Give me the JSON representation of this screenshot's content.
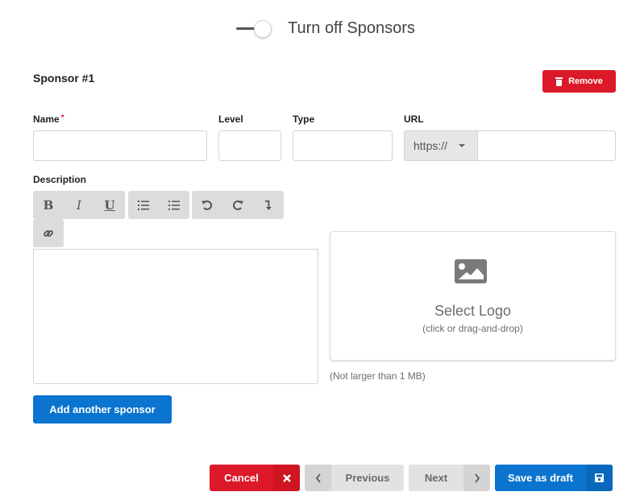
{
  "toggle": {
    "label": "Turn off Sponsors",
    "state": "on"
  },
  "sponsor": {
    "title": "Sponsor #1",
    "remove_label": "Remove",
    "fields": {
      "name": {
        "label": "Name",
        "required_mark": "*",
        "value": ""
      },
      "level": {
        "label": "Level",
        "value": ""
      },
      "type": {
        "label": "Type",
        "value": ""
      },
      "url": {
        "label": "URL",
        "protocol": "https://",
        "value": ""
      }
    },
    "description": {
      "label": "Description",
      "toolbar": [
        "bold",
        "italic",
        "underline",
        "ordered-list",
        "bullet-list",
        "undo",
        "redo",
        "text-direction",
        "link"
      ],
      "value": ""
    },
    "logo": {
      "title": "Select Logo",
      "subtitle": "(click or drag-and-drop)",
      "note": "(Not larger than 1 MB)"
    }
  },
  "add_sponsor_label": "Add another sponsor",
  "footer": {
    "cancel": "Cancel",
    "previous": "Previous",
    "next": "Next",
    "save": "Save as draft"
  },
  "colors": {
    "danger": "#dc1928",
    "primary": "#0a74cf",
    "neutral": "#e2e2e2"
  }
}
